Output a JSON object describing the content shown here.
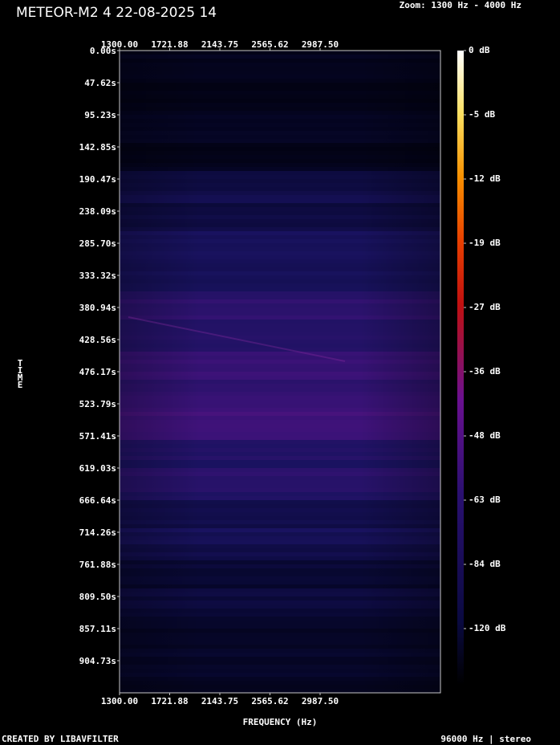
{
  "title": "METEOR-M2 4 22-08-2025 14",
  "zoom_text": "Zoom: 1300 Hz - 4000 Hz",
  "footer_left": "CREATED BY LIBAVFILTER",
  "footer_right": "96000 Hz | stereo",
  "chart_data": {
    "type": "heatmap",
    "xlabel": "FREQUENCY (Hz)",
    "ylabel": "TIME",
    "x_ticks": [
      "1300.00",
      "1721.88",
      "2143.75",
      "2565.62",
      "2987.50"
    ],
    "x_tick_values": [
      1300.0,
      1721.88,
      2143.75,
      2565.62,
      2987.5
    ],
    "xlim": [
      1300,
      4000
    ],
    "y_ticks": [
      "0.00s",
      "47.62s",
      "95.23s",
      "142.85s",
      "190.47s",
      "238.09s",
      "285.70s",
      "333.32s",
      "380.94s",
      "428.56s",
      "476.17s",
      "523.79s",
      "571.41s",
      "619.03s",
      "666.64s",
      "714.26s",
      "761.88s",
      "809.50s",
      "857.11s",
      "904.73s"
    ],
    "y_tick_values": [
      0,
      47.62,
      95.23,
      142.85,
      190.47,
      238.09,
      285.7,
      333.32,
      380.94,
      428.56,
      476.17,
      523.79,
      571.41,
      619.03,
      666.64,
      714.26,
      761.88,
      809.5,
      857.11,
      904.73
    ],
    "ylim": [
      0,
      952.36
    ],
    "colorbar": {
      "labels": [
        "0 dB",
        "-5 dB",
        "-12 dB",
        "-19 dB",
        "-27 dB",
        "-36 dB",
        "-48 dB",
        "-63 dB",
        "-84 dB",
        "-120 dB"
      ],
      "colors": [
        "#000000",
        "#0a0a40",
        "#3a1080",
        "#7a109a",
        "#c01010",
        "#e03000",
        "#f07000",
        "#f8b000",
        "#fce060",
        "#ffffff"
      ]
    },
    "rows": [
      {
        "t": 0,
        "level": 0.05
      },
      {
        "t": 95,
        "level": 0.06
      },
      {
        "t": 160,
        "level": 0.09
      },
      {
        "t": 190,
        "level": 0.2
      },
      {
        "t": 240,
        "level": 0.25
      },
      {
        "t": 290,
        "level": 0.3
      },
      {
        "t": 340,
        "level": 0.34
      },
      {
        "t": 380,
        "level": 0.4
      },
      {
        "t": 430,
        "level": 0.42
      },
      {
        "t": 480,
        "level": 0.44
      },
      {
        "t": 520,
        "level": 0.5
      },
      {
        "t": 570,
        "level": 0.43
      },
      {
        "t": 620,
        "level": 0.38
      },
      {
        "t": 670,
        "level": 0.32
      },
      {
        "t": 720,
        "level": 0.26
      },
      {
        "t": 760,
        "level": 0.22
      },
      {
        "t": 810,
        "level": 0.19
      },
      {
        "t": 860,
        "level": 0.15
      },
      {
        "t": 910,
        "level": 0.1
      },
      {
        "t": 952,
        "level": 0.12
      }
    ]
  }
}
